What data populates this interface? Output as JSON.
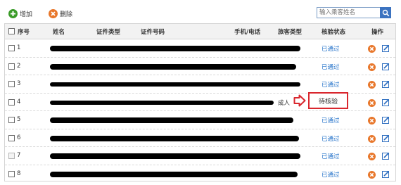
{
  "toolbar": {
    "add_label": "增加",
    "delete_label": "删除",
    "search_placeholder": "输入乘客姓名"
  },
  "table": {
    "headers": {
      "select": "序号",
      "name": "姓名",
      "id_type": "证件类型",
      "id_number": "证件号码",
      "phone": "手机/电话",
      "passenger_type": "旅客类型",
      "verify_status": "核验状态",
      "actions": "操作"
    },
    "rows": [
      {
        "no": "1",
        "status": "已通过"
      },
      {
        "no": "2",
        "status": "已通过"
      },
      {
        "no": "3",
        "status": "已通过"
      },
      {
        "no": "4",
        "status": "待核验",
        "passenger_type": "成人"
      },
      {
        "no": "5",
        "status": "已通过"
      },
      {
        "no": "6",
        "status": "已通过"
      },
      {
        "no": "7",
        "status": "已通过"
      },
      {
        "no": "8",
        "status": "已通过"
      }
    ]
  },
  "colors": {
    "link": "#1e6ec8",
    "highlight": "#d9272e",
    "add_icon": "#3a9b28",
    "delete_icon": "#e8772b",
    "edit_icon": "#2f6fc0"
  }
}
